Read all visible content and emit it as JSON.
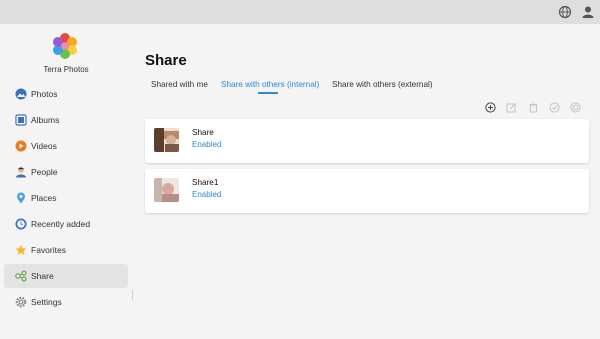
{
  "app": {
    "name": "Terra Photos"
  },
  "topbar": {
    "globe_icon": "globe-icon",
    "user_icon": "user-icon"
  },
  "sidebar": {
    "items": [
      {
        "label": "Photos",
        "icon": "photos-icon"
      },
      {
        "label": "Albums",
        "icon": "albums-icon"
      },
      {
        "label": "Videos",
        "icon": "videos-icon"
      },
      {
        "label": "People",
        "icon": "people-icon"
      },
      {
        "label": "Places",
        "icon": "places-icon"
      },
      {
        "label": "Recently added",
        "icon": "recently-added-icon"
      },
      {
        "label": "Favorites",
        "icon": "star-icon"
      },
      {
        "label": "Share",
        "icon": "share-icon",
        "active": true
      },
      {
        "label": "Settings",
        "icon": "gear-icon"
      }
    ]
  },
  "main": {
    "title": "Share",
    "tabs": [
      {
        "label": "Shared with me"
      },
      {
        "label": "Share with others (internal)",
        "active": true
      },
      {
        "label": "Share with others (external)"
      }
    ],
    "actions": [
      "add-icon",
      "edit-icon",
      "delete-icon",
      "enable-icon",
      "disable-icon"
    ],
    "shares": [
      {
        "name": "Share",
        "status": "Enabled"
      },
      {
        "name": "Share1",
        "status": "Enabled"
      }
    ]
  },
  "colors": {
    "accent": "#2a8ad4",
    "active_nav": "#e3e3e3",
    "background": "#f4f4f4"
  }
}
